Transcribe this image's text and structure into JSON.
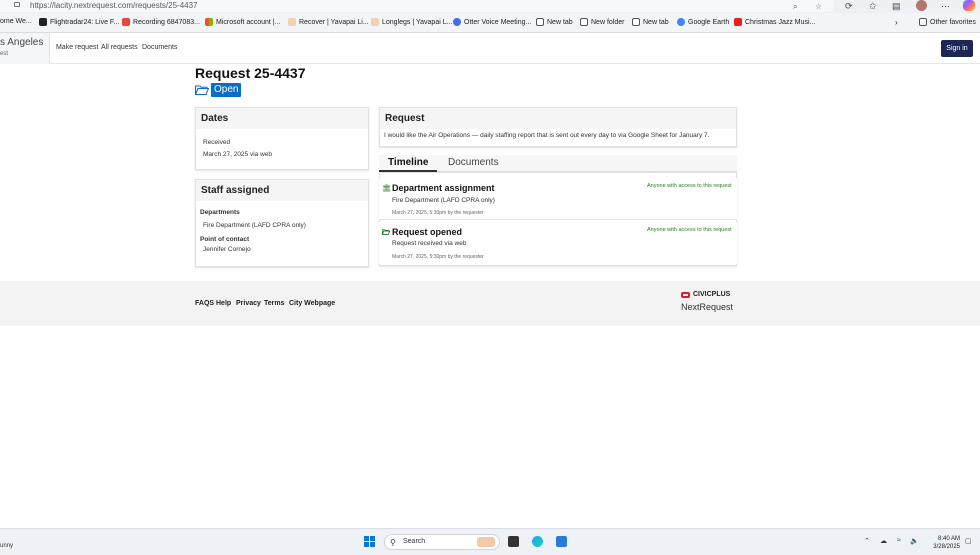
{
  "browser": {
    "url": "https://lacity.nextrequest.com/requests/25-4437",
    "bookmarks": [
      {
        "label": "ome We...",
        "color": "#ffffff"
      },
      {
        "label": "Flightradar24: Live F...",
        "color": "#222222"
      },
      {
        "label": "Recording 6847083...",
        "color": "#e8453c"
      },
      {
        "label": "Microsoft account |...",
        "color": "#f25022"
      },
      {
        "label": "Recover | Yavapai Li...",
        "color": "#f0d2b0"
      },
      {
        "label": "Longlegs | Yavapai L...",
        "color": "#f0d2b0"
      },
      {
        "label": "Otter Voice Meeting...",
        "color": "#3f6ee8"
      },
      {
        "label": "New tab",
        "color": "#555555"
      },
      {
        "label": "New folder",
        "color": "#555555"
      },
      {
        "label": "New tab",
        "color": "#555555"
      },
      {
        "label": "Google Earth",
        "color": "#4285f4"
      },
      {
        "label": "Christmas Jazz Musi...",
        "color": "#e62117"
      }
    ],
    "other_favorites": "Other favorites"
  },
  "site": {
    "brand_title": "s Angeles",
    "brand_sub": "est",
    "nav": [
      "Make request",
      "All requests",
      "Documents"
    ],
    "sign_in": "Sign in"
  },
  "request": {
    "title": "Request 25-4437",
    "status": "Open",
    "dates_heading": "Dates",
    "received_label": "Received",
    "received_value": "March 27, 2025 via web",
    "staff_heading": "Staff assigned",
    "departments_label": "Departments",
    "departments_value": "Fire Department (LAFD CPRA only)",
    "poc_label": "Point of contact",
    "poc_value": "Jennifer Cornejo",
    "request_heading": "Request",
    "request_text": "I would like the Air Operations — daily staffing report that is sent out every day to via Google Sheet for January 7."
  },
  "tabs": {
    "timeline": "Timeline",
    "documents": "Documents"
  },
  "timeline": [
    {
      "title": "Department assignment",
      "detail": "Fire Department (LAFD CPRA only)",
      "visibility": "Anyone with access to this request",
      "meta": "March 27, 2025, 5:30pm by the requester"
    },
    {
      "title": "Request opened",
      "detail": "Request received via web",
      "visibility": "Anyone with access to this request",
      "meta": "March 27, 2025, 5:30pm by the requester"
    }
  ],
  "footer": {
    "links": [
      "FAQS",
      "Help",
      "Privacy",
      "Terms",
      "City Webpage"
    ],
    "civicplus": "CIVICPLUS",
    "nextrequest": "NextRequest"
  },
  "taskbar": {
    "weather": "unny",
    "search": "Search",
    "time": "8:40 AM",
    "date": "3/28/2025"
  }
}
